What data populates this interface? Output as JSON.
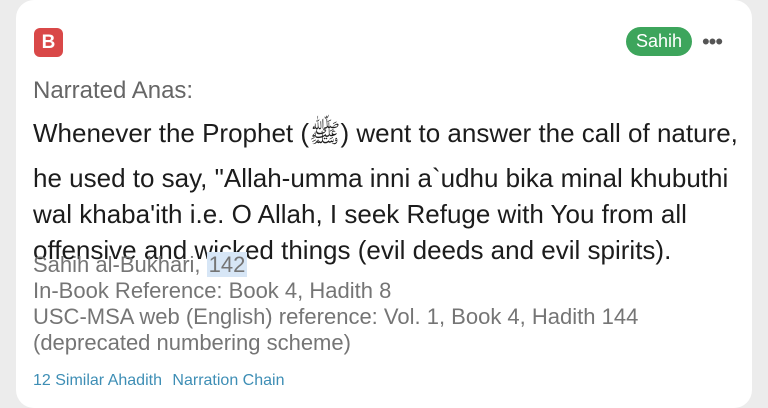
{
  "header": {
    "book_badge": "B",
    "grade": "Sahih",
    "more_glyph": "•••",
    "book_badge_color": "#d94848",
    "grade_color": "#3da55c"
  },
  "hadith": {
    "narrator": "Narrated Anas:",
    "lines": [
      "Whenever the Prophet (ﷺ) went to answer the call of nature,",
      "he used to say, \"Allah-umma inni a`udhu bika minal khubuthi",
      "wal khaba'ith i.e. O Allah, I seek Refuge with You from all",
      "offensive and wicked things (evil deeds and evil spirits)."
    ]
  },
  "references": {
    "collection": "Sahih al-Bukhari,",
    "number": "142",
    "in_book": "In-Book Reference: Book 4, Hadith 8",
    "usc_msa": "USC-MSA web (English) reference: Vol. 1, Book 4, Hadith 144",
    "usc_msa_note": "(deprecated numbering scheme)"
  },
  "links": {
    "similar": "12 Similar Ahadith",
    "chain": "Narration Chain",
    "link_color": "#3e8eb5"
  }
}
